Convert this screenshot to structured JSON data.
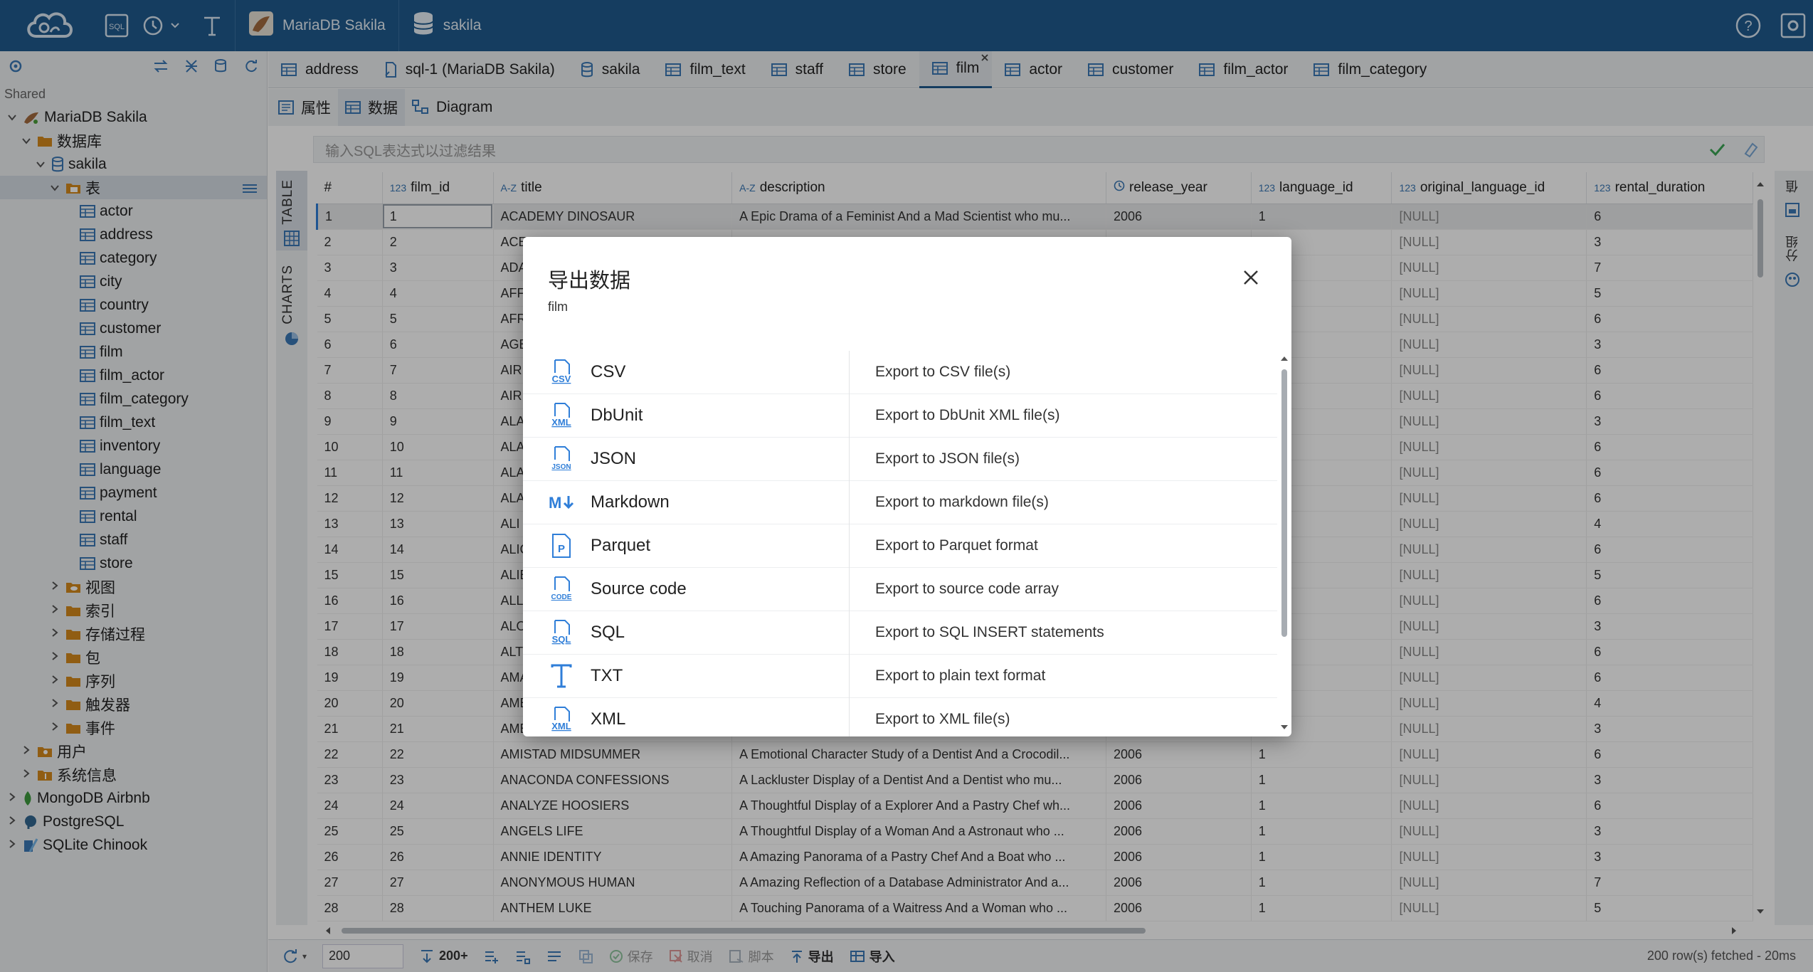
{
  "topbar": {
    "connection": "MariaDB Sakila",
    "database": "sakila"
  },
  "sidebar": {
    "group": "Shared",
    "tree": [
      {
        "label": "MariaDB Sakila",
        "level": 0,
        "chev": "v",
        "icon": "mariadb"
      },
      {
        "label": "数据库",
        "level": 1,
        "chev": "v",
        "icon": "folder"
      },
      {
        "label": "sakila",
        "level": 2,
        "chev": "v",
        "icon": "db"
      },
      {
        "label": "表",
        "level": 3,
        "chev": "v",
        "icon": "folder-table",
        "selected": true
      },
      {
        "label": "actor",
        "level": 4,
        "icon": "table"
      },
      {
        "label": "address",
        "level": 4,
        "icon": "table"
      },
      {
        "label": "category",
        "level": 4,
        "icon": "table"
      },
      {
        "label": "city",
        "level": 4,
        "icon": "table"
      },
      {
        "label": "country",
        "level": 4,
        "icon": "table"
      },
      {
        "label": "customer",
        "level": 4,
        "icon": "table"
      },
      {
        "label": "film",
        "level": 4,
        "icon": "table"
      },
      {
        "label": "film_actor",
        "level": 4,
        "icon": "table"
      },
      {
        "label": "film_category",
        "level": 4,
        "icon": "table"
      },
      {
        "label": "film_text",
        "level": 4,
        "icon": "table"
      },
      {
        "label": "inventory",
        "level": 4,
        "icon": "table"
      },
      {
        "label": "language",
        "level": 4,
        "icon": "table"
      },
      {
        "label": "payment",
        "level": 4,
        "icon": "table"
      },
      {
        "label": "rental",
        "level": 4,
        "icon": "table"
      },
      {
        "label": "staff",
        "level": 4,
        "icon": "table"
      },
      {
        "label": "store",
        "level": 4,
        "icon": "table"
      },
      {
        "label": "视图",
        "level": 3,
        "chev": ">",
        "icon": "folder-view"
      },
      {
        "label": "索引",
        "level": 3,
        "chev": ">",
        "icon": "folder"
      },
      {
        "label": "存储过程",
        "level": 3,
        "chev": ">",
        "icon": "folder"
      },
      {
        "label": "包",
        "level": 3,
        "chev": ">",
        "icon": "folder"
      },
      {
        "label": "序列",
        "level": 3,
        "chev": ">",
        "icon": "folder"
      },
      {
        "label": "触发器",
        "level": 3,
        "chev": ">",
        "icon": "folder"
      },
      {
        "label": "事件",
        "level": 3,
        "chev": ">",
        "icon": "folder"
      },
      {
        "label": "用户",
        "level": 1,
        "chev": ">",
        "icon": "folder-user"
      },
      {
        "label": "系统信息",
        "level": 1,
        "chev": ">",
        "icon": "folder-info"
      },
      {
        "label": "MongoDB Airbnb",
        "level": 0,
        "chev": ">",
        "icon": "mongo"
      },
      {
        "label": "PostgreSQL",
        "level": 0,
        "chev": ">",
        "icon": "postgres"
      },
      {
        "label": "SQLite Chinook",
        "level": 0,
        "chev": ">",
        "icon": "sqlite"
      }
    ]
  },
  "tabs": [
    {
      "label": "address",
      "icon": "table"
    },
    {
      "label": "sql-1 (MariaDB Sakila)",
      "icon": "sql"
    },
    {
      "label": "sakila",
      "icon": "db"
    },
    {
      "label": "film_text",
      "icon": "table"
    },
    {
      "label": "staff",
      "icon": "table"
    },
    {
      "label": "store",
      "icon": "table"
    },
    {
      "label": "film",
      "icon": "table",
      "active": true
    },
    {
      "label": "actor",
      "icon": "table"
    },
    {
      "label": "customer",
      "icon": "table"
    },
    {
      "label": "film_actor",
      "icon": "table"
    },
    {
      "label": "film_category",
      "icon": "table"
    }
  ],
  "subtabs": [
    {
      "label": "属性",
      "icon": "props"
    },
    {
      "label": "数据",
      "icon": "table",
      "active": true
    },
    {
      "label": "Diagram",
      "icon": "diagram"
    }
  ],
  "filter": {
    "placeholder": "输入SQL表达式以过滤结果"
  },
  "side_labels": {
    "table": "TABLE",
    "charts": "CHARTS",
    "right1": "值",
    "right2": "分组"
  },
  "grid": {
    "columns": [
      {
        "type": "",
        "name": "#"
      },
      {
        "type": "123",
        "name": "film_id"
      },
      {
        "type": "A-Z",
        "name": "title"
      },
      {
        "type": "A-Z",
        "name": "description"
      },
      {
        "type": "clock",
        "name": "release_year"
      },
      {
        "type": "123",
        "name": "language_id"
      },
      {
        "type": "123",
        "name": "original_language_id"
      },
      {
        "type": "123",
        "name": "rental_duration"
      }
    ],
    "rows": [
      [
        "1",
        "1",
        "ACADEMY DINOSAUR",
        "A Epic Drama of a Feminist And a Mad Scientist who mu...",
        "2006",
        "1",
        "[NULL]",
        "6"
      ],
      [
        "2",
        "2",
        "ACE",
        "",
        "",
        "",
        "[NULL]",
        "3"
      ],
      [
        "3",
        "3",
        "ADA",
        "",
        "",
        "",
        "[NULL]",
        "7"
      ],
      [
        "4",
        "4",
        "AFF",
        "",
        "",
        "",
        "[NULL]",
        "5"
      ],
      [
        "5",
        "5",
        "AFR",
        "",
        "",
        "",
        "[NULL]",
        "6"
      ],
      [
        "6",
        "6",
        "AGE",
        "",
        "",
        "",
        "[NULL]",
        "3"
      ],
      [
        "7",
        "7",
        "AIRI",
        "",
        "",
        "",
        "[NULL]",
        "6"
      ],
      [
        "8",
        "8",
        "AIRI",
        "",
        "",
        "",
        "[NULL]",
        "6"
      ],
      [
        "9",
        "9",
        "ALA",
        "",
        "",
        "",
        "[NULL]",
        "3"
      ],
      [
        "10",
        "10",
        "ALA",
        "",
        "",
        "",
        "[NULL]",
        "6"
      ],
      [
        "11",
        "11",
        "ALA",
        "",
        "",
        "",
        "[NULL]",
        "6"
      ],
      [
        "12",
        "12",
        "ALA",
        "",
        "",
        "",
        "[NULL]",
        "6"
      ],
      [
        "13",
        "13",
        "ALI",
        "",
        "",
        "",
        "[NULL]",
        "4"
      ],
      [
        "14",
        "14",
        "ALIC",
        "",
        "",
        "",
        "[NULL]",
        "6"
      ],
      [
        "15",
        "15",
        "ALIE",
        "",
        "",
        "",
        "[NULL]",
        "5"
      ],
      [
        "16",
        "16",
        "ALL",
        "",
        "",
        "",
        "[NULL]",
        "6"
      ],
      [
        "17",
        "17",
        "ALO",
        "",
        "",
        "",
        "[NULL]",
        "3"
      ],
      [
        "18",
        "18",
        "ALT",
        "",
        "",
        "",
        "[NULL]",
        "6"
      ],
      [
        "19",
        "19",
        "AMA",
        "",
        "",
        "",
        "[NULL]",
        "6"
      ],
      [
        "20",
        "20",
        "AME",
        "",
        "",
        "",
        "[NULL]",
        "4"
      ],
      [
        "21",
        "21",
        "AME",
        "",
        "",
        "",
        "[NULL]",
        "3"
      ],
      [
        "22",
        "22",
        "AMISTAD MIDSUMMER",
        "A Emotional Character Study of a Dentist And a Crocodil...",
        "2006",
        "1",
        "[NULL]",
        "6"
      ],
      [
        "23",
        "23",
        "ANACONDA CONFESSIONS",
        "A Lackluster Display of a Dentist And a Dentist who mu...",
        "2006",
        "1",
        "[NULL]",
        "3"
      ],
      [
        "24",
        "24",
        "ANALYZE HOOSIERS",
        "A Thoughtful Display of a Explorer And a Pastry Chef wh...",
        "2006",
        "1",
        "[NULL]",
        "6"
      ],
      [
        "25",
        "25",
        "ANGELS LIFE",
        "A Thoughtful Display of a Woman And a Astronaut who ...",
        "2006",
        "1",
        "[NULL]",
        "3"
      ],
      [
        "26",
        "26",
        "ANNIE IDENTITY",
        "A Amazing Panorama of a Pastry Chef And a Boat who ...",
        "2006",
        "1",
        "[NULL]",
        "3"
      ],
      [
        "27",
        "27",
        "ANONYMOUS HUMAN",
        "A Amazing Reflection of a Database Administrator And a...",
        "2006",
        "1",
        "[NULL]",
        "7"
      ],
      [
        "28",
        "28",
        "ANTHEM LUKE",
        "A Touching Panorama of a Waitress And a Woman who ...",
        "2006",
        "1",
        "[NULL]",
        "5"
      ]
    ]
  },
  "statusbar": {
    "limit": "200",
    "fetch_all": "200+",
    "save": "保存",
    "cancel": "取消",
    "script": "脚本",
    "export": "导出",
    "import": "导入",
    "summary": "200 row(s) fetched - 20ms"
  },
  "dialog": {
    "title": "导出数据",
    "subtitle": "film",
    "formats": [
      {
        "name": "CSV",
        "desc": "Export to CSV file(s)",
        "icon": "csv"
      },
      {
        "name": "DbUnit",
        "desc": "Export to DbUnit XML file(s)",
        "icon": "xml"
      },
      {
        "name": "JSON",
        "desc": "Export to JSON file(s)",
        "icon": "json"
      },
      {
        "name": "Markdown",
        "desc": "Export to markdown file(s)",
        "icon": "markdown"
      },
      {
        "name": "Parquet",
        "desc": "Export to Parquet format",
        "icon": "parquet"
      },
      {
        "name": "Source code",
        "desc": "Export to source code array",
        "icon": "code"
      },
      {
        "name": "SQL",
        "desc": "Export to SQL INSERT statements",
        "icon": "sql"
      },
      {
        "name": "TXT",
        "desc": "Export to plain text format",
        "icon": "txt"
      },
      {
        "name": "XML",
        "desc": "Export to XML file(s)",
        "icon": "xml"
      }
    ]
  },
  "colors": {
    "topbar": "#1f5b8e",
    "accent": "#2f7ed8",
    "null_text": "#888888"
  }
}
